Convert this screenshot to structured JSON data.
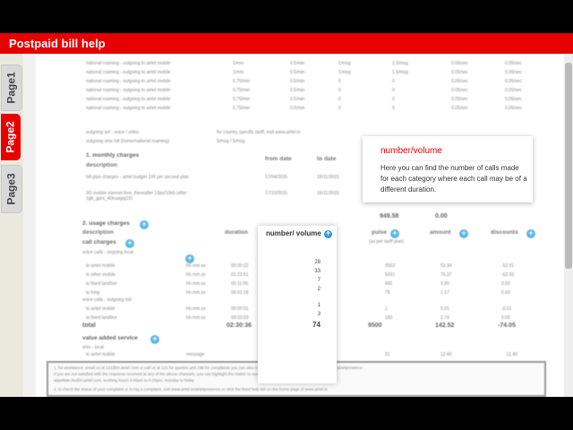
{
  "header": {
    "title": "Postpaid bill help"
  },
  "tabs": [
    {
      "label": "Page1",
      "active": false
    },
    {
      "label": "Page2",
      "active": true
    },
    {
      "label": "Page3",
      "active": false
    }
  ],
  "colors": {
    "brand_red": "#e60000",
    "info_blue": "#5cb6e6",
    "tab_bg": "#e9e9dd"
  },
  "bill": {
    "roaming_rows": [
      {
        "desc": "national roaming - outgoing to airtel mobile",
        "c1": "1/min",
        "c2": "0.5/min",
        "c3": "1/msg",
        "c4": "1.5/msg",
        "c5": "0.05/sec",
        "c6": "0.05/sec"
      },
      {
        "desc": "national roaming - outgoing to airtel mobile",
        "c1": "1/min",
        "c2": "0.5/min",
        "c3": "1/msg",
        "c4": "1.5/msg",
        "c5": "0.05/sec",
        "c6": "0.05/sec"
      },
      {
        "desc": "national roaming - outgoing to airtel mobile",
        "c1": "0.75/min",
        "c2": "0.5/min",
        "c3": "0",
        "c4": "0",
        "c5": "0.05/sec",
        "c6": "0.05/sec"
      },
      {
        "desc": "national roaming - outgoing to airtel mobile",
        "c1": "0.75/min",
        "c2": "0.5/min",
        "c3": "0",
        "c4": "0",
        "c5": "0.05/sec",
        "c6": "0.05/sec"
      },
      {
        "desc": "national roaming - outgoing to airtel mobile",
        "c1": "0.75/min",
        "c2": "0.5/min",
        "c3": "0",
        "c4": "0",
        "c5": "0.05/sec",
        "c6": "0.05/sec"
      },
      {
        "desc": "national roaming - outgoing to airtel mobile",
        "c1": "0.75/min",
        "c2": "0.5/min",
        "c3": "0",
        "c4": "0",
        "c5": "0.05/sec",
        "c6": "0.05/sec"
      }
    ],
    "voice_video_row": {
      "desc": "outgoing isd - voice / video",
      "note": "for country specific tariff, visit www.airtel.in"
    },
    "sms_row": {
      "desc": "outgoing sms intl (home/national roaming)",
      "val": "5/msg / 5/msg"
    },
    "monthly": {
      "title": "1. monthly charges",
      "desc_head": "description",
      "from_head": "from date",
      "to_head": "to date",
      "rows": [
        {
          "desc": "bill plan charges - airtel budget 149 per second plan",
          "from": "17/04/2015",
          "to": "16/11/2015"
        },
        {
          "desc": "3G mobile internet free, thereafter 10ps/10kb (after 1gb_gprs_40ksaigig19)",
          "from": "17/10/2015",
          "to": "16/11/2015"
        }
      ],
      "subtotal": "949.58",
      "subtotal2": "0.00"
    },
    "usage": {
      "title": "2. usage charges",
      "desc_head": "description",
      "duration_head": "duration",
      "pulse_head": "pulse",
      "pulse_sub": "(as per tariff plan)",
      "amount_head": "amount",
      "discounts_head": "discounts",
      "call_charges": "call charges",
      "voice_local": "voice calls - ongoing local",
      "voice_std": "voice calls - outgoing std",
      "rows": [
        {
          "desc": "to airtel mobile",
          "unit": "hh.mm.ss",
          "duration": "00:00:22",
          "volume": "28",
          "pulse": "3562",
          "amount": "53.34",
          "discount": "-52.01"
        },
        {
          "desc": "to other mobile",
          "unit": "hh.mm.ss",
          "duration": "01:23:51",
          "volume": "33",
          "pulse": "5031",
          "amount": "75.37",
          "discount": "-62.03"
        },
        {
          "desc": "to fixed landline",
          "unit": "hh.mm.ss",
          "duration": "00:11:05",
          "volume": "7",
          "pulse": "665",
          "amount": "9.80",
          "discount": "0.00"
        },
        {
          "desc": "to tring",
          "unit": "hh.mm.ss",
          "duration": "00:01:18",
          "volume": "2",
          "pulse": "78",
          "amount": "1.17",
          "discount": "0.00"
        },
        {
          "desc": "to airtel mobile",
          "unit": "hh.mm.ss",
          "duration": "00:00:01",
          "volume": "1",
          "pulse": "1",
          "amount": "0.01",
          "discount": "-0.01"
        },
        {
          "desc": "to fixed landline",
          "unit": "hh.mm.ss",
          "duration": "00:03:03",
          "volume": "3",
          "pulse": "183",
          "amount": "2.74",
          "discount": "0.00"
        }
      ],
      "total_label": "total",
      "total_duration": "02:30:36",
      "total_volume": "74",
      "total_pulse": "9500",
      "total_amount": "142.52",
      "total_discount": "-74.05",
      "vas_title": "value added service",
      "vas_sub": "sms - local",
      "vas_row": {
        "desc": "to airtel mobile",
        "unit": "message",
        "volume": "21",
        "pulse": "21",
        "amount": "12.60",
        "discount": "-11.40"
      }
    },
    "highlight": {
      "title": "number/ volume"
    },
    "footer": {
      "line1": "1. for assistance, email us at 121@in.airtel.com or call us at 121 for queries and 198 for complaints you can also contact us through our website - www.airtel.in/airtelpresence",
      "line2": "   if you are not satisfied with the response received at any of the above channels, you can highlight the matter to our appellate authority at 9000000001, email at",
      "line3": "   appellate.ds@in.airtel.com, working hours 9.00am to 6.00pm, monday to friday",
      "line4": "2. to check the status of your complaint or to log a complaint, visit www.airtel.in/airtelpresence or click the fixed help tab on the home page of www.airtel.in"
    }
  },
  "tooltip": {
    "title": "number/volume",
    "text": "Here you can find the number of calls made for each category where each call may be of a different duration."
  }
}
